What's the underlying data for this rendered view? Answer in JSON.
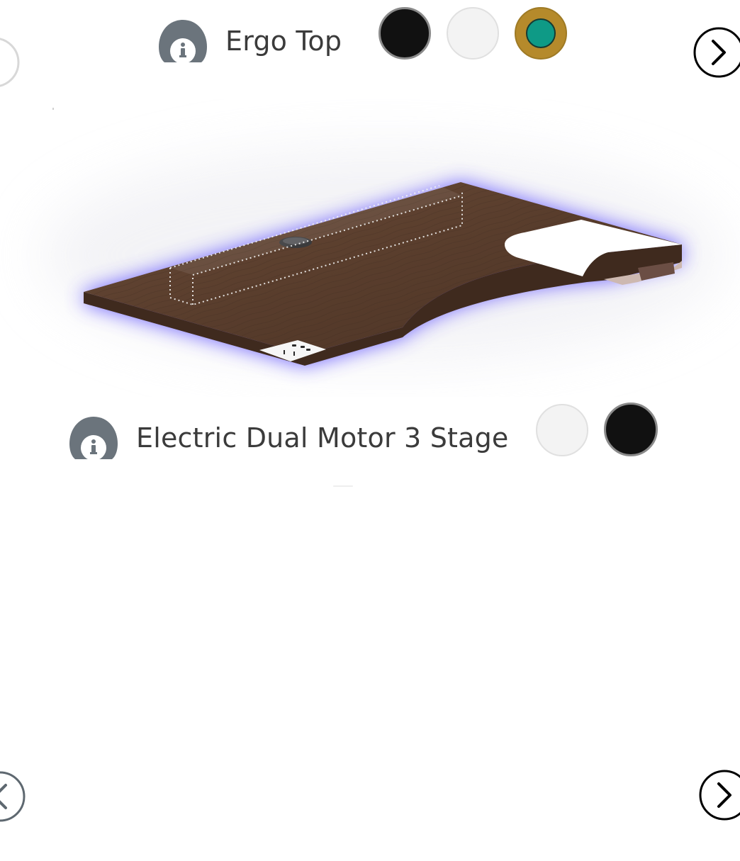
{
  "configurator": {
    "top_section": {
      "title": "Ergo Top",
      "info_icon": "info-icon",
      "color_options": [
        {
          "name": "black",
          "color": "#111111",
          "selected": false
        },
        {
          "name": "white",
          "color": "#f3f3f3",
          "selected": false
        },
        {
          "name": "walnut",
          "color": "#0e9a86",
          "ring": "#b58a2b",
          "selected": true
        }
      ],
      "prev_icon": "chevron-left-icon",
      "next_icon": "chevron-right-icon"
    },
    "base_section": {
      "title": "Electric Dual Motor 3 Stage",
      "info_icon": "info-icon",
      "color_options": [
        {
          "name": "white",
          "color": "#f3f3f3",
          "selected": false
        },
        {
          "name": "black",
          "color": "#111111",
          "selected": false
        }
      ],
      "prev_icon": "chevron-left-icon",
      "next_icon": "chevron-right-icon"
    },
    "product_image": {
      "description_icon": "desk-top-preview",
      "glow_color": "#5a4cff",
      "wood_color": "#5b4030"
    }
  }
}
